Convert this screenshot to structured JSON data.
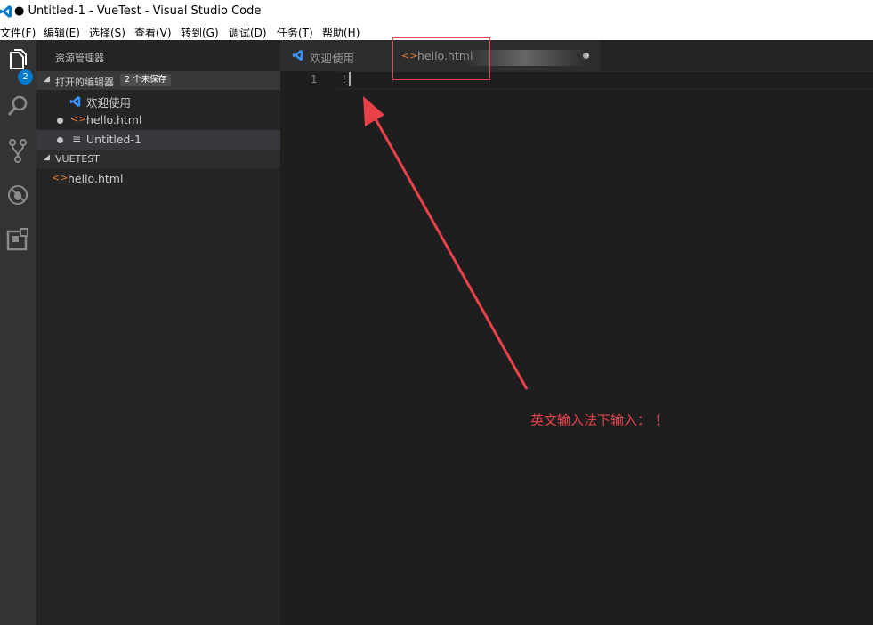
{
  "window": {
    "title": "● Untitled-1 - VueTest - Visual Studio Code"
  },
  "menu": [
    "文件(F)",
    "编辑(E)",
    "选择(S)",
    "查看(V)",
    "转到(G)",
    "调试(D)",
    "任务(T)",
    "帮助(H)"
  ],
  "activity": {
    "explorer_badge": "2"
  },
  "sidebar": {
    "title": "资源管理器",
    "open_editors": {
      "label": "打开的编辑器",
      "badge": "2 个未保存",
      "items": [
        "欢迎使用",
        "hello.html",
        "Untitled-1"
      ]
    },
    "project": {
      "label": "VUETEST",
      "items": [
        "hello.html"
      ]
    }
  },
  "tabs": [
    "欢迎使用",
    "hello.html"
  ],
  "editor": {
    "line_number": "1",
    "content": "!"
  },
  "annotation": {
    "text": "英文输入法下输入：  ！"
  },
  "colors": {
    "accent": "#007acc",
    "html_icon": "#e37933",
    "annotation": "#e8414a"
  }
}
